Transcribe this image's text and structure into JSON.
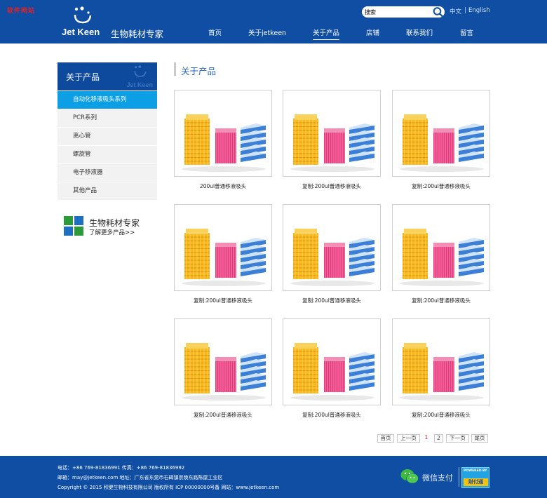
{
  "header": {
    "corner_mark": "软件网站",
    "logo_en": "Jet Keen",
    "logo_cn": "生物耗材专家",
    "search_placeholder": "搜索",
    "lang_cn": "中文",
    "lang_sep": "|",
    "lang_en": "English",
    "nav": [
      {
        "label": "首页"
      },
      {
        "label": "关于jetkeen"
      },
      {
        "label": "关于产品",
        "active": true
      },
      {
        "label": "店铺"
      },
      {
        "label": "联系我们"
      },
      {
        "label": "留言"
      }
    ]
  },
  "sidebar": {
    "title": "关于产品",
    "watermark": "Jet Keen",
    "items": [
      {
        "label": "自动化移液吸头系列",
        "active": true
      },
      {
        "label": "PCR系列"
      },
      {
        "label": "离心管"
      },
      {
        "label": "螺旋管"
      },
      {
        "label": "电子移液器"
      },
      {
        "label": "其他产品"
      }
    ],
    "promo_title": "生物耗材专家",
    "promo_link": "了解更多产品>>"
  },
  "main": {
    "title": "关于产品",
    "products": [
      {
        "name": "200ul普通移液吸头"
      },
      {
        "name": "复制:200ul普通移液吸头"
      },
      {
        "name": "复制:200ul普通移液吸头"
      },
      {
        "name": "复制:200ul普通移液吸头"
      },
      {
        "name": "复制:200ul普通移液吸头"
      },
      {
        "name": "复制:200ul普通移液吸头"
      },
      {
        "name": "复制:200ul普通移液吸头"
      },
      {
        "name": "复制:200ul普通移液吸头"
      },
      {
        "name": "复制:200ul普通移液吸头"
      }
    ]
  },
  "pagination": {
    "first": "首页",
    "prev": "上一页",
    "page1": "1",
    "page2": "2",
    "next": "下一页",
    "last": "尾页",
    "current": 1
  },
  "footer": {
    "line1": "电话：+86 769-81836991   传真：+86 769-81836992",
    "line2": "邮箱：may@jetkeen.com   地址：广东省东莞市石碣镇崇焕东路陈屋工业区",
    "line3": "Copyright © 2015 积健生物科技有限公司  版权所有  ICP 00000000号备   网站：www.jetkeen.com",
    "wechat_label": "微信支付",
    "powered_top": "POWERED BY",
    "powered_bottom": "财付通"
  },
  "colors": {
    "header_blue": "#0f4ea2",
    "sidebar_active": "#0d9fe6",
    "title_blue": "#2a66b6",
    "current_page": "#e0222b"
  },
  "icons": {
    "logo": "jetkeen-dots-icon",
    "search": "search-icon",
    "promo": "grid-squares-icon",
    "wechat": "wechat-icon"
  }
}
